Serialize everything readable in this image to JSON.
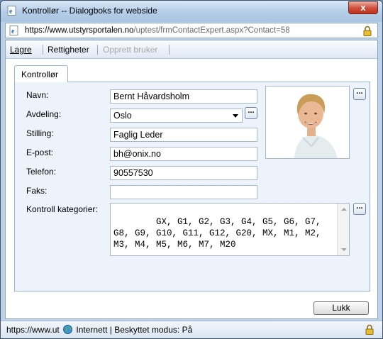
{
  "window": {
    "title": "Kontrollør -- Dialogboks for webside",
    "close_label": "x"
  },
  "address": {
    "scheme": "https://www.",
    "domain": "utstyrsportalen.no",
    "path": "/uptest/frmContactExpert.aspx?Contact=58"
  },
  "toolbar": {
    "save_label": "Lagre",
    "rights_label": "Rettigheter",
    "create_user_label": "Opprett bruker"
  },
  "tab": {
    "label": "Kontrollør"
  },
  "form": {
    "name_label": "Navn:",
    "name_value": "Bernt Håvardsholm",
    "department_label": "Avdeling:",
    "department_value": "Oslo",
    "position_label": "Stilling:",
    "position_value": "Faglig Leder",
    "email_label": "E-post:",
    "email_value": "bh@onix.no",
    "phone_label": "Telefon:",
    "phone_value": "90557530",
    "fax_label": "Faks:",
    "fax_value": "",
    "categories_label": "Kontroll kategorier:",
    "categories_value": "GX, G1, G2, G3, G4, G5, G6, G7, G8, G9, G10, G11, G12, G20, MX, M1, M2, M3, M4, M5, M6, M7, M20",
    "ellipsis_label": "..."
  },
  "footer": {
    "close_label": "Lukk"
  },
  "status": {
    "url": "https://www.ut",
    "zone": "Internett | Beskyttet modus: På"
  },
  "colors": {
    "frame": "#bcd3ea",
    "panel": "#edf3fa",
    "close_button": "#c22e17"
  }
}
